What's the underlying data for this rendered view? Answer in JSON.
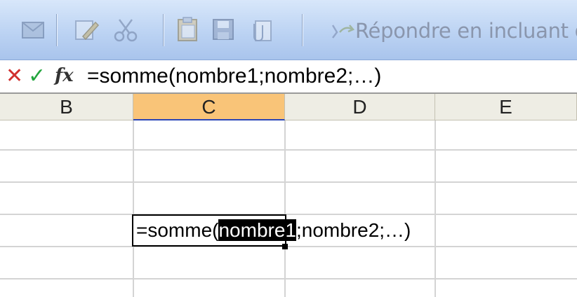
{
  "toolbar": {
    "icons": [
      "email-icon",
      "edit-icon",
      "cut-icon",
      "clipboard-icon",
      "save-icon",
      "attachment-icon"
    ],
    "reply_label": "Répondre en incluant des"
  },
  "formula_bar": {
    "cancel_symbol": "✕",
    "enter_symbol": "✓",
    "fx_label": "fx",
    "text": "=somme(nombre1;nombre2;…)"
  },
  "columns": {
    "headers": [
      "B",
      "C",
      "D",
      "E"
    ],
    "active": "C"
  },
  "cell_editor": {
    "prefix": "=somme(",
    "highlighted_argument": "nombre1",
    "suffix": ";nombre2;…)"
  },
  "colors": {
    "active_header": "#f9c478",
    "toolbar_blue": "#bcd3f3",
    "cancel_red": "#d1312f",
    "enter_green": "#22a53d"
  }
}
